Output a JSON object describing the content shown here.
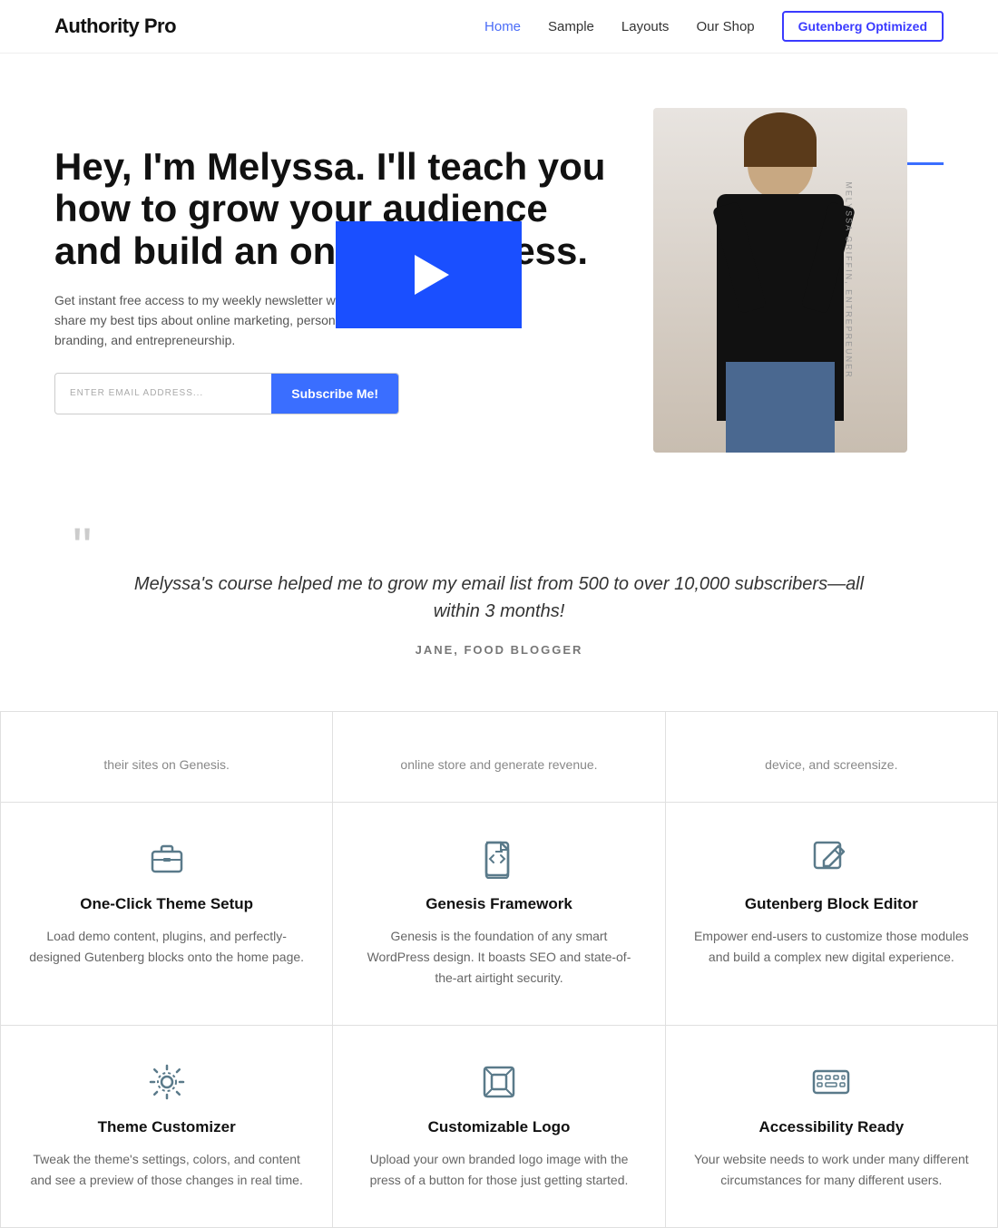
{
  "header": {
    "logo": "Authority Pro",
    "nav": [
      {
        "label": "Home",
        "active": true
      },
      {
        "label": "Sample",
        "active": false
      },
      {
        "label": "Layouts",
        "active": false
      },
      {
        "label": "Our Shop",
        "active": false
      }
    ],
    "cta_button": "Gutenberg Optimized"
  },
  "hero": {
    "title": "Hey, I'm Melyssa. I'll teach you how to grow your audience and build an online business.",
    "description": "Get instant free access to my weekly newsletter where I share my best tips about online marketing, personal branding, and entrepreneurship.",
    "email_placeholder": "ENTER EMAIL ADDRESS...",
    "subscribe_label": "Subscribe Me!",
    "image_caption": "MELYSSA GRIFFIN, ENTREPREUNER"
  },
  "quote": {
    "text": "Melyssa's course helped me to grow my email list from 500 to over 10,000 subscribers—all within 3 months!",
    "author": "JANE, FOOD BLOGGER"
  },
  "features_partial": [
    {
      "text": "their sites on Genesis."
    },
    {
      "text": "online store and generate revenue."
    },
    {
      "text": "device, and screensize."
    }
  ],
  "features": [
    {
      "icon": "briefcase",
      "title": "One-Click Theme Setup",
      "desc": "Load demo content, plugins, and perfectly-designed Gutenberg blocks onto the home page."
    },
    {
      "icon": "code",
      "title": "Genesis Framework",
      "desc": "Genesis is the foundation of any smart WordPress design. It boasts SEO and state-of-the-art airtight security."
    },
    {
      "icon": "edit",
      "title": "Gutenberg Block Editor",
      "desc": "Empower end-users to customize those modules and build a complex new digital experience."
    },
    {
      "icon": "gear",
      "title": "Theme Customizer",
      "desc": "Tweak the theme's settings, colors, and content and see a preview of those changes in real time."
    },
    {
      "icon": "logo",
      "title": "Customizable Logo",
      "desc": "Upload your own branded logo image with the press of a button for those just getting started."
    },
    {
      "icon": "access",
      "title": "Accessibility Ready",
      "desc": "Your website needs to work under many different circumstances for many different users."
    }
  ]
}
